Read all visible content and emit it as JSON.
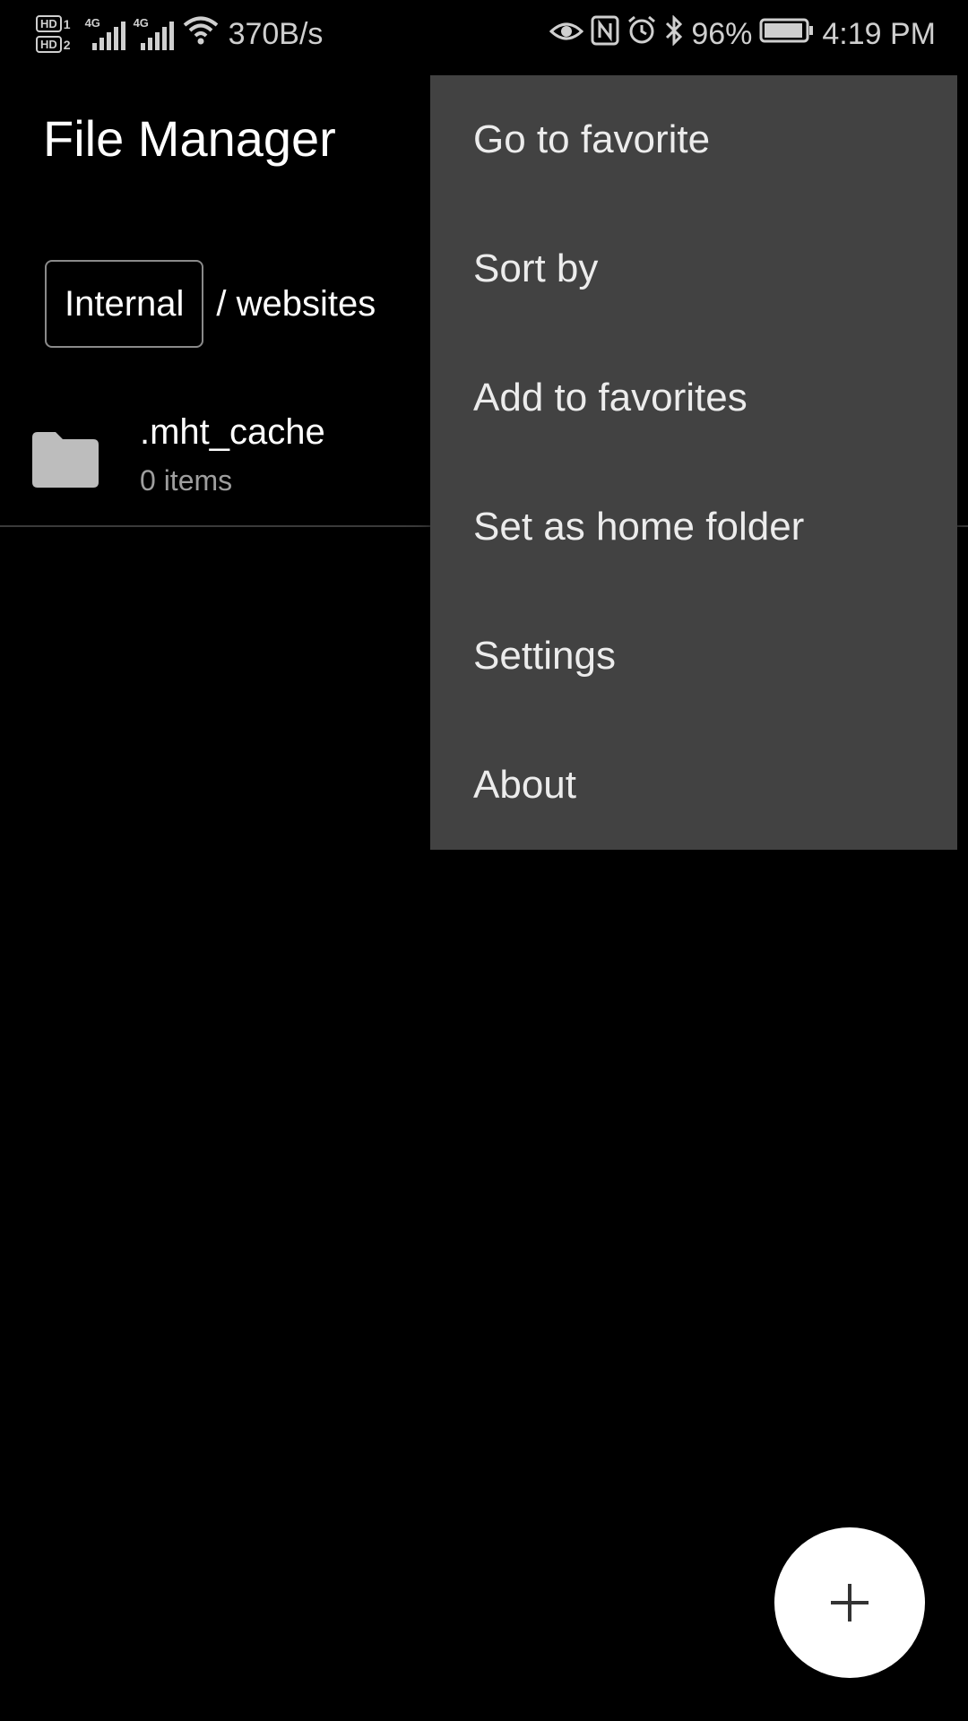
{
  "status_bar": {
    "hd_badges": [
      {
        "label": "HD",
        "sim": "1"
      },
      {
        "label": "HD",
        "sim": "2"
      }
    ],
    "networks": [
      {
        "generation": "4G",
        "icon": "signal-bars-icon"
      },
      {
        "generation": "4G",
        "icon": "signal-bars-icon"
      }
    ],
    "wifi_icon": "wifi-icon",
    "net_speed": "370B/s",
    "eye_icon": "eye-comfort-icon",
    "nfc_icon": "nfc-icon",
    "alarm_icon": "alarm-icon",
    "bluetooth_icon": "bluetooth-icon",
    "battery_percent": "96%",
    "battery_level": 0.96,
    "time": "4:19 PM"
  },
  "header": {
    "title": "File Manager"
  },
  "breadcrumb": {
    "root": "Internal",
    "path": "/ websites"
  },
  "files": [
    {
      "icon": "folder-icon",
      "name": ".mht_cache",
      "meta": "0 items"
    }
  ],
  "menu": {
    "items": [
      {
        "label": "Go to favorite"
      },
      {
        "label": "Sort by"
      },
      {
        "label": "Add to favorites"
      },
      {
        "label": "Set as home folder"
      },
      {
        "label": "Settings"
      },
      {
        "label": "About"
      }
    ]
  },
  "fab": {
    "icon": "plus-icon"
  },
  "colors": {
    "background": "#000000",
    "menu_background": "#424242",
    "fab_background": "#ffffff",
    "secondary_text": "#9e9e9e"
  }
}
